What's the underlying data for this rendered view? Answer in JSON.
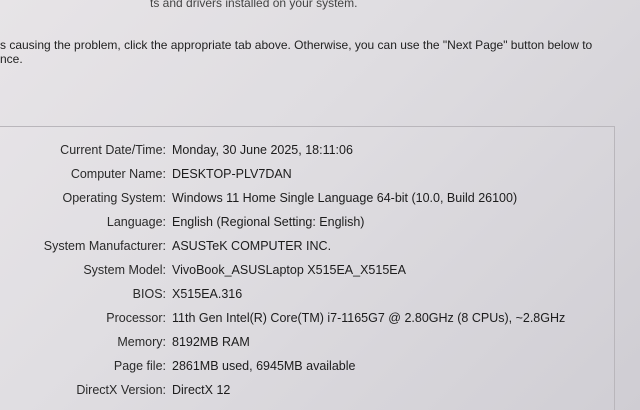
{
  "intro": {
    "line1": "ts and drivers installed on your system.",
    "line2": "s causing the problem, click the appropriate tab above.  Otherwise, you can use the \"Next Page\" button below to",
    "line3": "nce."
  },
  "system_info": [
    {
      "label": "Current Date/Time:",
      "value": "Monday, 30 June 2025, 18:11:06"
    },
    {
      "label": "Computer Name:",
      "value": "DESKTOP-PLV7DAN"
    },
    {
      "label": "Operating System:",
      "value": "Windows 11 Home Single Language 64-bit (10.0, Build 26100)"
    },
    {
      "label": "Language:",
      "value": "English (Regional Setting: English)"
    },
    {
      "label": "System Manufacturer:",
      "value": "ASUSTeK COMPUTER INC."
    },
    {
      "label": "System Model:",
      "value": "VivoBook_ASUSLaptop X515EA_X515EA"
    },
    {
      "label": "BIOS:",
      "value": "X515EA.316"
    },
    {
      "label": "Processor:",
      "value": "11th Gen Intel(R) Core(TM) i7-1165G7 @ 2.80GHz (8 CPUs), ~2.8GHz"
    },
    {
      "label": "Memory:",
      "value": "8192MB RAM"
    },
    {
      "label": "Page file:",
      "value": "2861MB used, 6945MB available"
    },
    {
      "label": "DirectX Version:",
      "value": "DirectX 12"
    }
  ]
}
